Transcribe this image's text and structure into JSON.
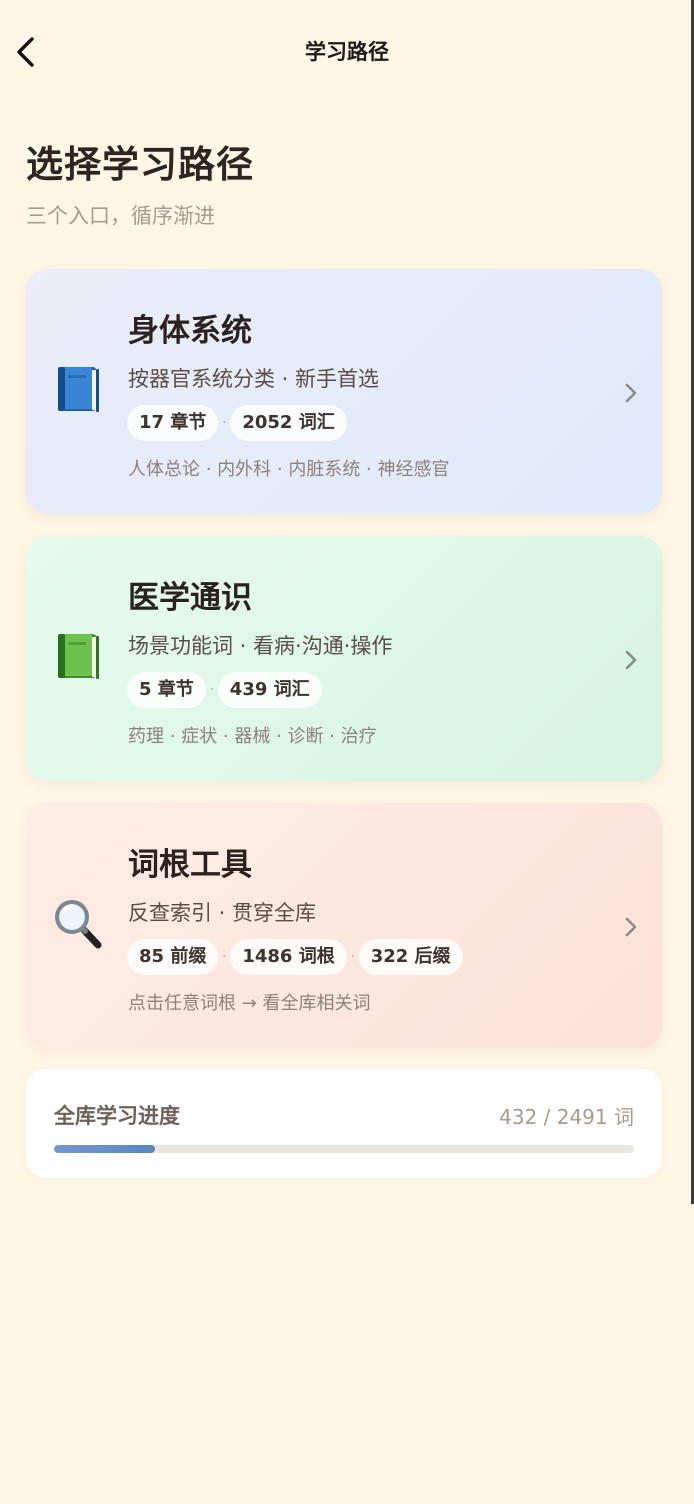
{
  "header": {
    "title": "学习路径"
  },
  "page": {
    "title": "选择学习路径",
    "subtitle": "三个入口，循序渐进"
  },
  "cards": [
    {
      "title": "身体系统",
      "desc": "按器官系统分类 · 新手首选",
      "icon": "blue-book-icon",
      "chips": [
        "17 章节",
        "2052 词汇"
      ],
      "tags": "人体总论 · 内外科 · 内脏系统 · 神经感官",
      "color": "#DFEAFC"
    },
    {
      "title": "医学通识",
      "desc": "场景功能词 · 看病·沟通·操作",
      "icon": "green-book-icon",
      "chips": [
        "5 章节",
        "439 词汇"
      ],
      "tags": "药理 · 症状 · 器械 · 诊断 · 治疗",
      "color": "#D7F4E2"
    },
    {
      "title": "词根工具",
      "desc": "反查索引 · 贯穿全库",
      "icon": "magnifier-icon",
      "chips": [
        "85 前缀",
        "1486 词根",
        "322 后缀"
      ],
      "tags": "点击任意词根 → 看全库相关词",
      "color": "#FCE2D8"
    }
  ],
  "progress": {
    "label": "全库学习进度",
    "count": "432 / 2491 词",
    "learned": 432,
    "total": 2491,
    "color": "#5A86C0"
  }
}
